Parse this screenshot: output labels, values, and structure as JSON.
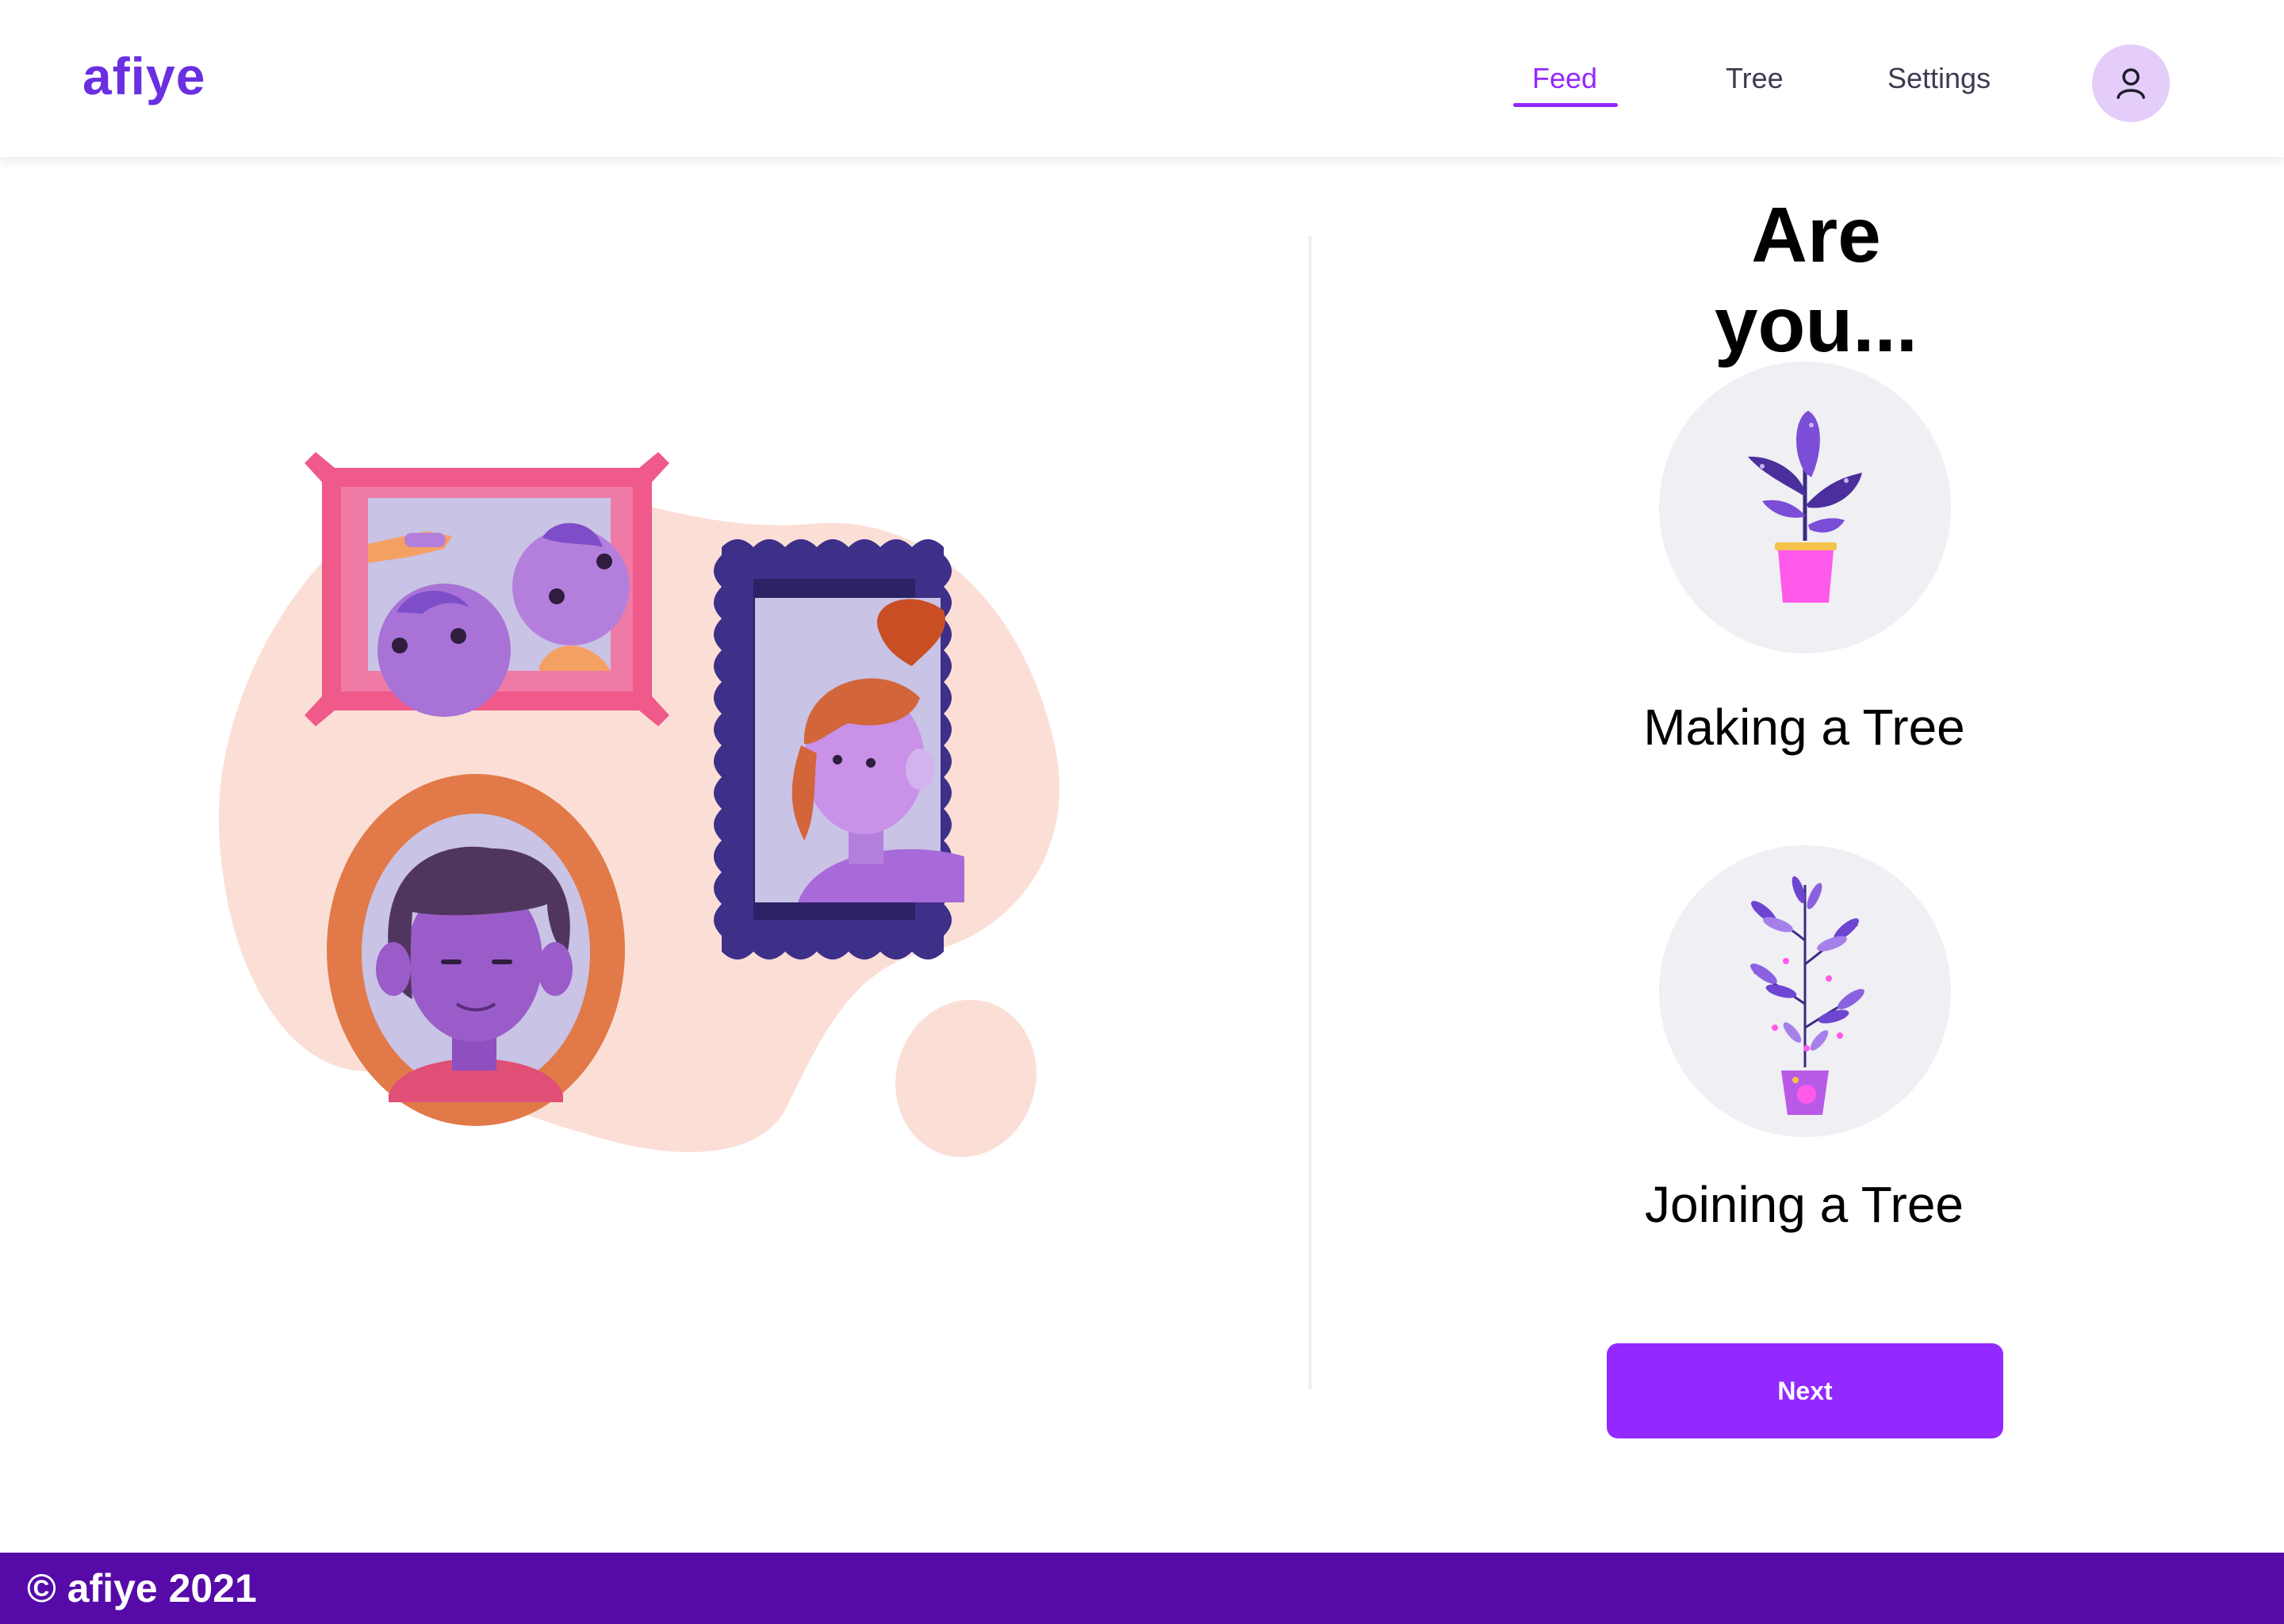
{
  "header": {
    "logo": "afiye",
    "nav": [
      {
        "label": "Feed",
        "active": true
      },
      {
        "label": "Tree",
        "active": false
      },
      {
        "label": "Settings",
        "active": false
      }
    ],
    "avatar_icon": "user-icon"
  },
  "main": {
    "question": "Are you...",
    "options": [
      {
        "label": "Making a Tree",
        "icon": "potted-plant-icon"
      },
      {
        "label": "Joining a Tree",
        "icon": "leafy-branch-plant-icon"
      }
    ],
    "next_label": "Next"
  },
  "illustration": {
    "name": "family-portraits-illustration"
  },
  "footer": {
    "text": "© afiye 2021"
  },
  "colors": {
    "accent": "#9329ff",
    "logo": "#6a2fe0",
    "footer": "#560ba8",
    "avatar_bg": "#e4cdf9",
    "option_bg": "#efeff4"
  }
}
